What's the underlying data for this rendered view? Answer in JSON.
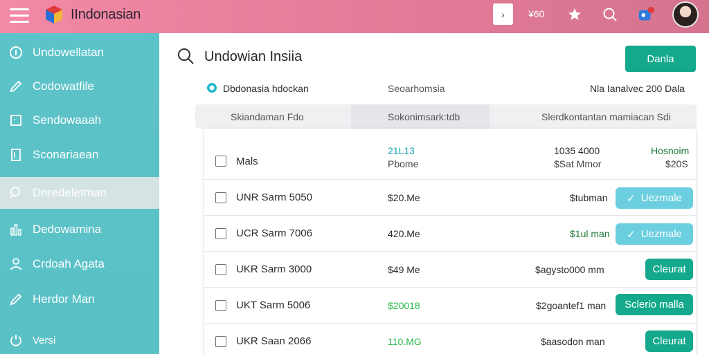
{
  "app": {
    "title": "IIndonasian"
  },
  "topbar": {
    "square_glyph": "›",
    "count": "¥60"
  },
  "sidebar": {
    "items": [
      {
        "label": "Undowellatan",
        "icon": "circle-info-icon"
      },
      {
        "label": "Codowatfile",
        "icon": "pencil-icon"
      },
      {
        "label": "Sendowaaah",
        "icon": "window-icon"
      },
      {
        "label": "Sconariaean",
        "icon": "document-icon"
      },
      {
        "label": "Dnredeletman",
        "icon": "search-icon"
      },
      {
        "label": "Dedowamina",
        "icon": "bar-chart-icon"
      },
      {
        "label": "Crdoah Agata",
        "icon": "user-icon"
      },
      {
        "label": "Herdor Man",
        "icon": "pencil-icon"
      },
      {
        "label": "Versi",
        "icon": "power-icon"
      }
    ]
  },
  "main": {
    "title": "Undowian Insiia",
    "primary_button": "Danla",
    "info": {
      "left": "Dbdonasia hdockan",
      "middle": "Seoarhomsia",
      "right": "Nla Ianalvec 200 Dala"
    },
    "tabs": [
      {
        "label": "Skiandaman Fdo"
      },
      {
        "label": "Sokonimsark:tdb"
      },
      {
        "label": "Slerdkontantan mamiacan Sdi"
      }
    ]
  },
  "table": {
    "header": {
      "name": "Mals",
      "col2_top": "21L13",
      "col2_bottom": "Pbome",
      "col3_top": "1035 4000",
      "col3_bottom": "$Sat Mmor",
      "col4_top": "Hosnoim",
      "col4_bottom": "$20S"
    },
    "rows": [
      {
        "name": "UNR Sarm 5050",
        "amount": "$20.Me",
        "amount_style": "plain",
        "status": "$tubman",
        "status_style": "plain",
        "action": "Uezmale",
        "action_style": "light"
      },
      {
        "name": "UCR Sarm 7006",
        "amount": "420.Me",
        "amount_style": "plain",
        "status": "$1ul man",
        "status_style": "dark-green",
        "action": "Uezmale",
        "action_style": "light"
      },
      {
        "name": "UKR Sarm 3000",
        "amount": "$49 Me",
        "amount_style": "plain",
        "status": "$agysto000 mm",
        "status_style": "plain",
        "action": "Cleurat",
        "action_style": "dark"
      },
      {
        "name": "UKT Sarm 5006",
        "amount": "$20018",
        "amount_style": "green-tail",
        "status": "$2goantef1 man",
        "status_style": "plain",
        "action": "Sclerio malla",
        "action_style": "dark"
      },
      {
        "name": "UKR Saan 2066",
        "amount": "110.MG",
        "amount_style": "green",
        "status": "$aasodon man",
        "status_style": "plain",
        "action": "Cleurat",
        "action_style": "dark"
      }
    ]
  },
  "colors": {
    "topbar": "#e27a97",
    "sidebar": "#5cc3c9",
    "accent": "#14a98c",
    "accent_light": "#6ccfe0"
  }
}
